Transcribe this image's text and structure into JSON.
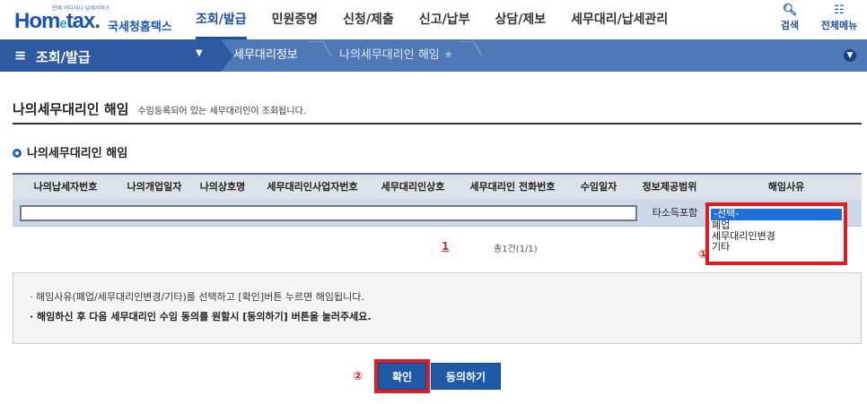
{
  "header": {
    "logo_tiny": "언제 어디서나 납세서비스",
    "logo_home": "Hom",
    "logo_e": "e",
    "logo_tax": "tax.",
    "logo_kr": "국세청홈택스",
    "nav": [
      "조회/발급",
      "민원증명",
      "신청/제출",
      "신고/납부",
      "상담/제보",
      "세무대리/납세관리"
    ],
    "search_label": "검색",
    "allmenu_label": "전체메뉴"
  },
  "breadcrumb": {
    "main": "조회/발급",
    "level2": "세무대리정보",
    "level3": "나의세무대리인 해임"
  },
  "page": {
    "title": "나의세무대리인 해임",
    "description": "수임등록되어 있는 세무대리인이 조회됩니다.",
    "section_title": "나의세무대리인 해임"
  },
  "table": {
    "headers": [
      "나의납세자번호",
      "나의개업일자",
      "나의상호명",
      "세무대리인사업자번호",
      "세무대리인상호",
      "세무대리인 전화번호",
      "수임일자",
      "정보제공범위",
      "해임사유"
    ],
    "row": {
      "scope": "타소득포함"
    },
    "reason_options": [
      "-선택-",
      "폐업",
      "세무대리인변경",
      "기타"
    ]
  },
  "pagination": {
    "current": "1",
    "total": "총1건(1/1)"
  },
  "notice": {
    "line1": "· 해임사유(폐업/세무대리인변경/기타)를 선택하고 [확인]버튼 누르면 해임됩니다.",
    "line2": "· 해임하신 후 다음 세무대리인 수임 동의를 원할시 [동의하기] 버튼을 눌러주세요."
  },
  "buttons": {
    "confirm": "확인",
    "agree": "동의하기"
  },
  "markers": {
    "one": "①",
    "two": "②"
  },
  "colors": {
    "primary": "#1f5aa8",
    "highlight": "#e21b23",
    "crumb_bar": "#4e78b7"
  }
}
